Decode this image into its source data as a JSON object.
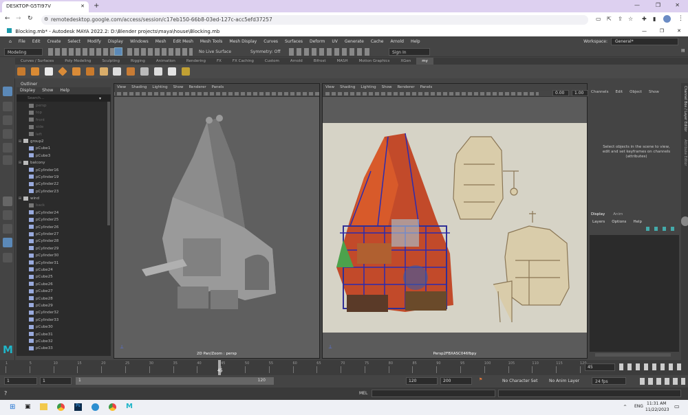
{
  "browser": {
    "tab_title": "DESKTOP-G5TI97V",
    "url": "remotedesktop.google.com/access/session/c17eb150-66b8-03ed-127c-acc5efd37257"
  },
  "maya": {
    "title": "Blocking.mb* - Autodesk MAYA 2022.2: D:\\Blender projects\\maya\\house\\Blocking.mb",
    "menus": [
      "File",
      "Edit",
      "Create",
      "Select",
      "Modify",
      "Display",
      "Windows",
      "Mesh",
      "Edit Mesh",
      "Mesh Tools",
      "Mesh Display",
      "Curves",
      "Surfaces",
      "Deform",
      "UV",
      "Generate",
      "Cache",
      "Arnold",
      "Help"
    ],
    "workspace_label": "Workspace:",
    "workspace_value": "General*",
    "mode": "Modeling",
    "live_surface": "No Live Surface",
    "symmetry": "Symmetry: Off",
    "sign_in": "Sign In",
    "shelf_tabs": [
      "Curves / Surfaces",
      "Poly Modeling",
      "Sculpting",
      "Rigging",
      "Animation",
      "Rendering",
      "FX",
      "FX Caching",
      "Custom",
      "Arnold",
      "Bifrost",
      "MASH",
      "Motion Graphics",
      "XGen",
      "my"
    ],
    "outliner": {
      "title": "Outliner",
      "menus": [
        "Display",
        "Show",
        "Help"
      ],
      "search_placeholder": "Search...",
      "rows": [
        {
          "label": "persp",
          "kind": "cam",
          "dim": true
        },
        {
          "label": "top",
          "kind": "cam",
          "dim": true
        },
        {
          "label": "front",
          "kind": "cam",
          "dim": true
        },
        {
          "label": "side",
          "kind": "cam",
          "dim": true
        },
        {
          "label": "left",
          "kind": "cam",
          "dim": true
        },
        {
          "label": "group2",
          "kind": "grp",
          "dim": false
        },
        {
          "label": "pCube1",
          "kind": "mesh",
          "dim": false
        },
        {
          "label": "pCube3",
          "kind": "mesh",
          "dim": false
        },
        {
          "label": "balcony",
          "kind": "grp",
          "dim": false
        },
        {
          "label": "pCylinder16",
          "kind": "mesh",
          "dim": false
        },
        {
          "label": "pCylinder19",
          "kind": "mesh",
          "dim": false
        },
        {
          "label": "pCylinder22",
          "kind": "mesh",
          "dim": false
        },
        {
          "label": "pCylinder23",
          "kind": "mesh",
          "dim": false
        },
        {
          "label": "wind",
          "kind": "grp",
          "dim": false
        },
        {
          "label": "back",
          "kind": "cam",
          "dim": true
        },
        {
          "label": "pCylinder24",
          "kind": "mesh",
          "dim": false
        },
        {
          "label": "pCylinder25",
          "kind": "mesh",
          "dim": false
        },
        {
          "label": "pCylinder26",
          "kind": "mesh",
          "dim": false
        },
        {
          "label": "pCylinder27",
          "kind": "mesh",
          "dim": false
        },
        {
          "label": "pCylinder28",
          "kind": "mesh",
          "dim": false
        },
        {
          "label": "pCylinder29",
          "kind": "mesh",
          "dim": false
        },
        {
          "label": "pCylinder30",
          "kind": "mesh",
          "dim": false
        },
        {
          "label": "pCylinder31",
          "kind": "mesh",
          "dim": false
        },
        {
          "label": "pCube24",
          "kind": "mesh",
          "dim": false
        },
        {
          "label": "pCube25",
          "kind": "mesh",
          "dim": false
        },
        {
          "label": "pCube26",
          "kind": "mesh",
          "dim": false
        },
        {
          "label": "pCube27",
          "kind": "mesh",
          "dim": false
        },
        {
          "label": "pCube28",
          "kind": "mesh",
          "dim": false
        },
        {
          "label": "pCube29",
          "kind": "mesh",
          "dim": false
        },
        {
          "label": "pCylinder32",
          "kind": "mesh",
          "dim": false
        },
        {
          "label": "pCylinder33",
          "kind": "mesh",
          "dim": false
        },
        {
          "label": "pCube30",
          "kind": "mesh",
          "dim": false
        },
        {
          "label": "pCube31",
          "kind": "mesh",
          "dim": false
        },
        {
          "label": "pCube32",
          "kind": "mesh",
          "dim": false
        },
        {
          "label": "pCube33",
          "kind": "mesh",
          "dim": false
        }
      ]
    },
    "viewport_menus": [
      "View",
      "Shading",
      "Lighting",
      "Show",
      "Renderer",
      "Panels"
    ],
    "viewport1_label": "2D Pan/Zoom : persp",
    "viewport2_label": "Persp2FBXASC046fbpy",
    "viewport2_exposure": "0.00",
    "viewport2_gamma": "1.00",
    "channel_box": {
      "menus": [
        "Channels",
        "Edit",
        "Object",
        "Show"
      ],
      "message": "Select objects in the scene to view, edit and set keyframes on channels (attributes)",
      "layer_tabs": [
        "Display",
        "Anim"
      ],
      "layer_menus": [
        "Layers",
        "Options",
        "Help"
      ],
      "side_tabs": [
        "Channel Box / Layer Editor",
        "Attribute Editor"
      ]
    },
    "timeline": {
      "ticks": [
        "1",
        "5",
        "10",
        "15",
        "20",
        "25",
        "30",
        "35",
        "40",
        "45",
        "50",
        "55",
        "60",
        "65",
        "70",
        "75",
        "80",
        "85",
        "90",
        "95",
        "100",
        "105",
        "110",
        "115",
        "120"
      ],
      "current_frame": "45",
      "current_frame_field": "45"
    },
    "range": {
      "start": "1",
      "start2": "1",
      "slider_start": "1",
      "slider_end": "120",
      "end": "120",
      "end2": "200",
      "character_set": "No Character Set",
      "anim_layer": "No Anim Layer",
      "fps": "24 fps"
    },
    "command_line": {
      "lang": "MEL"
    }
  },
  "taskbar": {
    "time": "11:31 AM",
    "date": "11/22/2023",
    "lang": "ENG"
  }
}
